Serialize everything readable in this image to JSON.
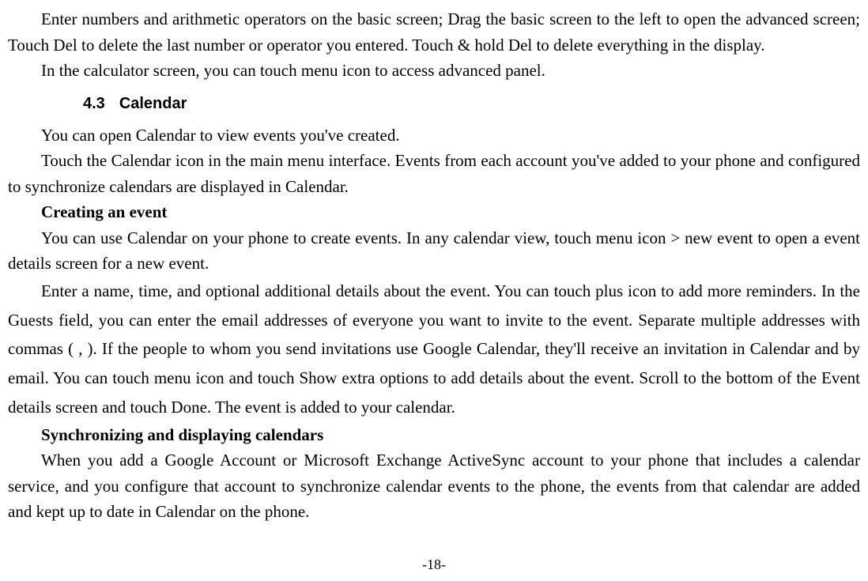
{
  "p1": "Enter numbers and arithmetic operators on the basic screen; Drag the basic screen to the left to open the advanced screen; Touch Del to delete the last number or operator you entered. Touch & hold Del to delete everything in the display.",
  "p2": "In the calculator screen, you can touch menu icon to access advanced panel.",
  "section_num": "4.3",
  "section_title": "Calendar",
  "p3": "You can open Calendar to view events you've created.",
  "p4": "Touch the Calendar icon in the main menu interface. Events from each account you've added to your phone and configured to synchronize calendars are displayed in Calendar.",
  "sub1": "Creating an event",
  "p5": "You can use Calendar on your phone to create events. In any calendar view, touch menu icon > new event to open a event details screen for a new event.",
  "p6a": "Enter a name, time, and optional additional details about the event. You can touch plus icon to add more reminders. In the Guests field, you can enter the email addresses of everyone you want to invite to the event. Separate multiple addresses with commas ( , ). If the people to whom you send invitations use Google Calendar, they'll receive an invitation in Calendar and by email. You can touch menu icon and touch Show extra options to add details about the event. ",
  "p6b": "Scroll to the bottom of the Event details screen and touch Done. The event is added to your calendar.",
  "sub2": "Synchronizing and displaying calendars",
  "p7": "When you add a Google Account or Microsoft Exchange ActiveSync account to your phone that includes a calendar service, and you configure that account to synchronize calendar events to the phone, the events from that calendar are added and kept up to date in Calendar on the phone.",
  "page_number": "-18-"
}
